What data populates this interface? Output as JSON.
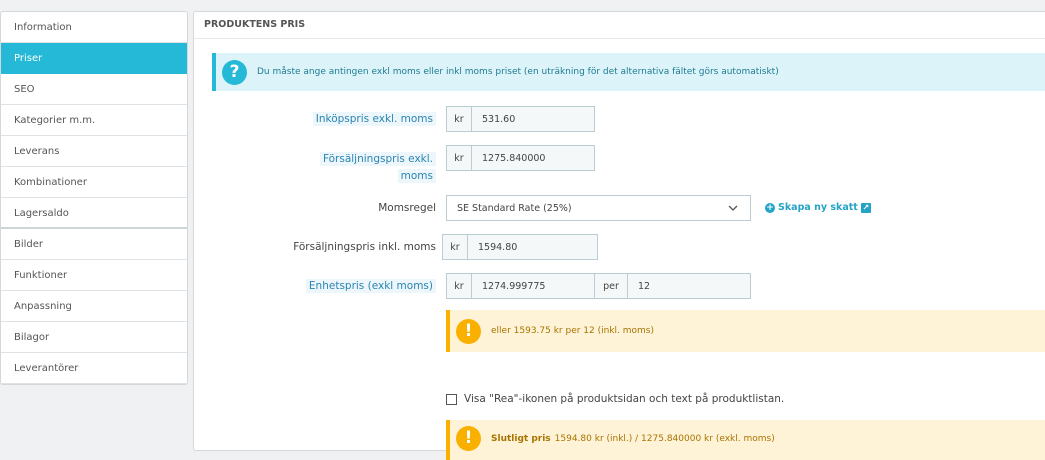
{
  "sidebar": {
    "items": [
      {
        "label": "Information"
      },
      {
        "label": "Priser"
      },
      {
        "label": "SEO"
      },
      {
        "label": "Kategorier m.m."
      },
      {
        "label": "Leverans"
      },
      {
        "label": "Kombinationer"
      },
      {
        "label": "Lagersaldo"
      },
      {
        "label": "Bilder"
      },
      {
        "label": "Funktioner"
      },
      {
        "label": "Anpassning"
      },
      {
        "label": "Bilagor"
      },
      {
        "label": "Leverantörer"
      }
    ],
    "active_index": 1
  },
  "panel": {
    "title": "PRODUKTENS PRIS",
    "info_alert": "Du måste ange antingen exkl moms eller inkl moms priset (en uträkning för det alternativa fältet görs automatiskt)",
    "wholesale": {
      "label": "Inköpspris exkl. moms",
      "currency": "kr",
      "value": "531.60"
    },
    "retail_excl": {
      "label_line1": "Försäljningspris exkl.",
      "label_line2": "moms",
      "currency": "kr",
      "value": "1275.840000"
    },
    "tax_rule": {
      "label": "Momsregel",
      "selected": "SE Standard Rate (25%)",
      "new_tax_link": "Skapa ny skatt"
    },
    "retail_incl": {
      "label": "Försäljningspris inkl. moms",
      "currency": "kr",
      "value": "1594.80"
    },
    "unit_price": {
      "label": "Enhetspris (exkl moms)",
      "currency": "kr",
      "value": "1274.999775",
      "per_label": "per",
      "per_value": "12"
    },
    "unit_warning": "eller 1593.75 kr per 12 (inkl. moms)",
    "sale_checkbox": "Visa \"Rea\"-ikonen på produktsidan och text på produktlistan.",
    "final_price": {
      "label": "Slutligt pris",
      "text": "1594.80 kr (inkl.) / 1275.840000 kr (exkl. moms)"
    }
  },
  "colors": {
    "accent": "#25b9d7",
    "warning": "#fab000"
  },
  "icons": {
    "info": "question-circle-icon",
    "warning": "exclamation-circle-icon",
    "chevron": "chevron-down-icon"
  }
}
